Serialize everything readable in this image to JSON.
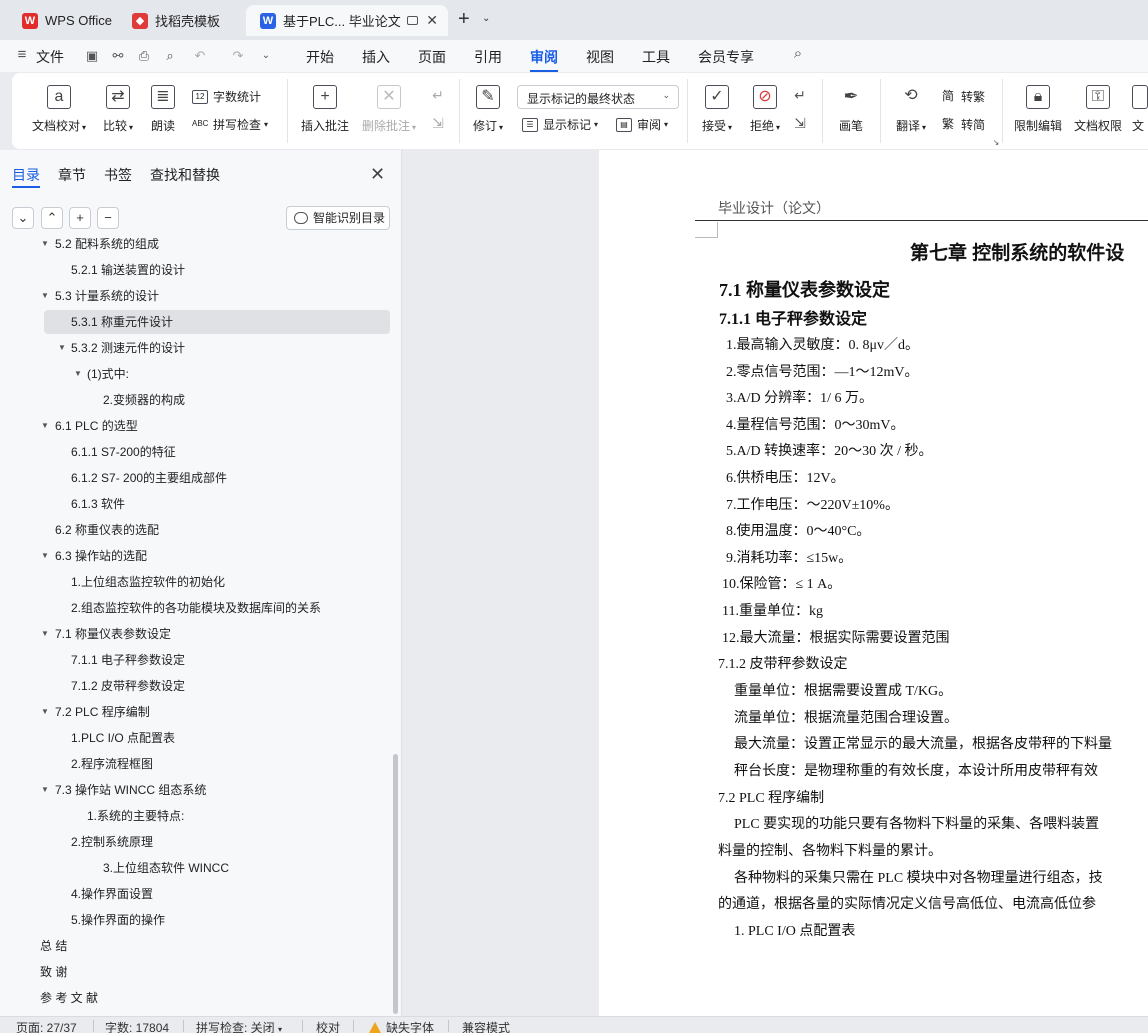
{
  "tabs": [
    {
      "label": "WPS Office",
      "icon": "wps-logo-icon",
      "color": "#e22c2c"
    },
    {
      "label": "找稻壳模板",
      "icon": "docer-icon",
      "color": "#e03b3b"
    },
    {
      "label": "基于PLC... 毕业论文",
      "icon": "wps-writer-icon",
      "color": "#2a62e6"
    }
  ],
  "menubar": {
    "file": "文件",
    "items": [
      "开始",
      "插入",
      "页面",
      "引用",
      "审阅",
      "视图",
      "工具",
      "会员专享"
    ],
    "active": "审阅"
  },
  "ribbon": {
    "proofread": "文档校对",
    "compare": "比较",
    "read_aloud": "朗读",
    "word_count": "字数统计",
    "spell_check": "拼写检查",
    "insert_comment": "插入批注",
    "delete_comment": "删除批注",
    "track_changes": "修订",
    "markup_select": "显示标记的最终状态",
    "show_markup": "显示标记",
    "review": "审阅",
    "accept": "接受",
    "reject": "拒绝",
    "pen": "画笔",
    "translate": "翻译",
    "trad_to_simp": "转繁",
    "simp_to_trad": "转简",
    "restrict_edit": "限制编辑",
    "doc_permission": "文档权限",
    "doc_more": "文"
  },
  "nav": {
    "tabs": [
      "目录",
      "章节",
      "书签",
      "查找和替换"
    ],
    "active_tab": "目录",
    "smart_toc": "智能识别目录",
    "toc": [
      {
        "text": "5.2  配料系统的组成",
        "level": 1,
        "expanded": true
      },
      {
        "text": "5.2.1  输送装置的设计",
        "level": 2
      },
      {
        "text": "5.3  计量系统的设计",
        "level": 1,
        "expanded": true
      },
      {
        "text": "5.3.1  称重元件设计",
        "level": 2,
        "selected": true
      },
      {
        "text": "5.3.2  测速元件的设计",
        "level": 2,
        "expanded": true
      },
      {
        "text": "(1)式中:",
        "level": 3,
        "expanded": true
      },
      {
        "text": "2.变频器的构成",
        "level": 4
      },
      {
        "text": "6.1 PLC 的选型",
        "level": 1,
        "expanded": true
      },
      {
        "text": "6.1.1 S7-200的特征",
        "level": 2
      },
      {
        "text": "6.1.2 S7- 200的主要组成部件",
        "level": 2
      },
      {
        "text": "6.1.3  软件",
        "level": 2
      },
      {
        "text": "6.2  称重仪表的选配",
        "level": 1
      },
      {
        "text": "6.3  操作站的选配",
        "level": 1,
        "expanded": true
      },
      {
        "text": "1.上位组态监控软件的初始化",
        "level": 2
      },
      {
        "text": "2.组态监控软件的各功能模块及数据库间的关系",
        "level": 2
      },
      {
        "text": "7.1  称量仪表参数设定",
        "level": 1,
        "expanded": true
      },
      {
        "text": "7.1.1  电子秤参数设定",
        "level": 2
      },
      {
        "text": "7.1.2  皮带秤参数设定",
        "level": 2
      },
      {
        "text": "7.2 PLC 程序编制",
        "level": 1,
        "expanded": true
      },
      {
        "text": "1.PLC I/O 点配置表",
        "level": 2
      },
      {
        "text": "2.程序流程框图",
        "level": 2
      },
      {
        "text": "7.3 操作站 WINCC 组态系统",
        "level": 1,
        "expanded": true
      },
      {
        "text": "1.系统的主要特点:",
        "level": 3
      },
      {
        "text": "2.控制系统原理",
        "level": 2
      },
      {
        "text": "3.上位组态软件 WINCC",
        "level": 4
      },
      {
        "text": "4.操作界面设置",
        "level": 2
      },
      {
        "text": "5.操作界面的操作",
        "level": 2
      },
      {
        "text": "总   结",
        "level": 0
      },
      {
        "text": "致  谢",
        "level": 0
      },
      {
        "text": "参 考 文 献",
        "level": 0
      }
    ]
  },
  "document": {
    "header": "毕业设计（论文）",
    "chapter_title": "第七章   控制系统的软件设",
    "h2_71": "7.1  称量仪表参数设定",
    "h3_711": "7.1.1  电子秤参数设定",
    "specs": [
      "1.最高输入灵敏度：0. 8μv／d。",
      "2.零点信号范围：—1～12mV。",
      "3.A/D 分辨率：1/ 6  万。",
      "4.量程信号范围：0～30mV。",
      "5.A/D 转换速率：20～30 次  /  秒。",
      "6.供桥电压：12V。",
      "7.工作电压：～220V±10%。",
      "8.使用温度：0～40°C。",
      "9.消耗功率：≤15w。",
      "10.保险管：≤ 1 A。",
      "11.重量单位：kg",
      "12.最大流量：根据实际需要设置范围"
    ],
    "h3_712": "7.1.2  皮带秤参数设定",
    "belt": [
      "重量单位：根据需要设置成 T/KG。",
      "流量单位：根据流量范围合理设置。",
      "最大流量：设置正常显示的最大流量，根据各皮带秤的下料量",
      "秤台长度：是物理称重的有效长度，本设计所用皮带秤有效"
    ],
    "h_72": "7.2 PLC 程序编制",
    "para1_a": "PLC 要实现的功能只要有各物料下料量的采集、各喂料装置",
    "para1_b": "料量的控制、各物料下料量的累计。",
    "para2_a": "各种物料的采集只需在 PLC 模块中对各物理量进行组态，技",
    "para2_b": "的通道，根据各量的实际情况定义信号高低位、电流高低位参",
    "list1": "1.   PLC I/O 点配置表"
  },
  "status": {
    "page": "页面: 27/37",
    "words": "字数: 17804",
    "spell": "拼写检查: 关闭",
    "proof": "校对",
    "missing_font": "缺失字体",
    "compat": "兼容模式"
  }
}
